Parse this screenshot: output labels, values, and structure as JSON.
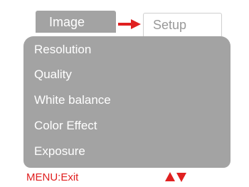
{
  "tabs": {
    "image_label": "Image",
    "setup_label": "Setup",
    "arrow_icon": "right-arrow-icon"
  },
  "menu": {
    "items": [
      {
        "label": "Resolution"
      },
      {
        "label": "Quality"
      },
      {
        "label": "White balance"
      },
      {
        "label": "Color Effect"
      },
      {
        "label": "Exposure"
      }
    ]
  },
  "footer": {
    "exit_label": "MENU:Exit",
    "nav_icon": "up-down-arrows-icon"
  },
  "colors": {
    "panel": "#a3a3a3",
    "accent": "#e02020",
    "text": "#ffffff",
    "inactive_tab_text": "#999999"
  }
}
